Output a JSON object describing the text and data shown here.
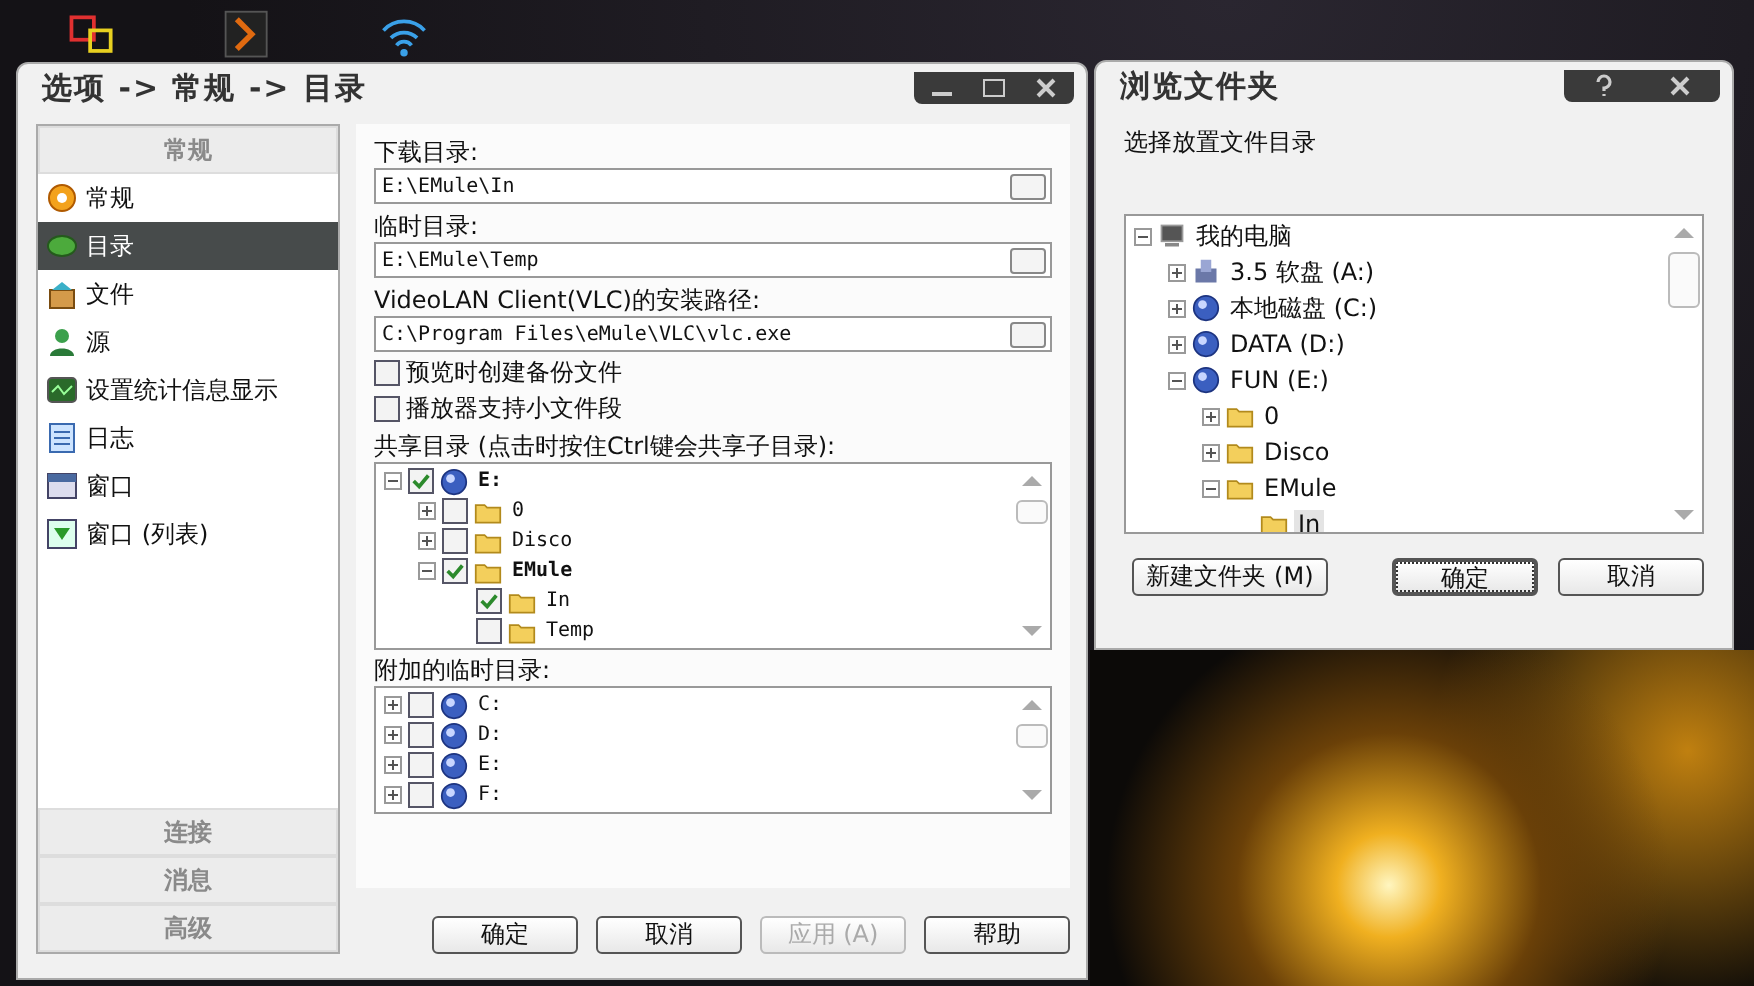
{
  "main_window": {
    "title": "选项 -> 常规 -> 目录",
    "sidebar": {
      "top_section": "常规",
      "items": [
        {
          "label": "常规",
          "kind": "general",
          "selected": false
        },
        {
          "label": "目录",
          "kind": "folder",
          "selected": true
        },
        {
          "label": "文件",
          "kind": "file",
          "selected": false
        },
        {
          "label": "源",
          "kind": "source",
          "selected": false
        },
        {
          "label": "设置统计信息显示",
          "kind": "stats",
          "selected": false
        },
        {
          "label": "日志",
          "kind": "log",
          "selected": false
        },
        {
          "label": "窗口",
          "kind": "window",
          "selected": false
        },
        {
          "label": "窗口 (列表)",
          "kind": "window-list",
          "selected": false
        }
      ],
      "bottom_sections": [
        "连接",
        "消息",
        "高级"
      ]
    },
    "fields": [
      {
        "label": "下载目录:",
        "value": "E:\\EMule\\In"
      },
      {
        "label": "临时目录:",
        "value": "E:\\EMule\\Temp"
      },
      {
        "label": "VideoLAN Client(VLC)的安装路径:",
        "value": "C:\\Program Files\\eMule\\VLC\\vlc.exe"
      }
    ],
    "options": [
      {
        "label": "预览时创建备份文件",
        "checked": false
      },
      {
        "label": "播放器支持小文件段",
        "checked": false
      }
    ],
    "shared": {
      "label": "共享目录 (点击时按住Ctrl键会共享子目录):",
      "tree": [
        {
          "label": "E:",
          "kind": "drive",
          "checked": true,
          "bold": true,
          "expanded": true,
          "children": [
            {
              "label": "0",
              "kind": "folder",
              "checked": false,
              "bold": false,
              "expanded": false
            },
            {
              "label": "Disco",
              "kind": "folder",
              "checked": false,
              "bold": false,
              "expanded": false
            },
            {
              "label": "EMule",
              "kind": "folder",
              "checked": true,
              "bold": true,
              "expanded": true,
              "children": [
                {
                  "label": "In",
                  "kind": "folder",
                  "checked": true,
                  "bold": false
                },
                {
                  "label": "Temp",
                  "kind": "folder",
                  "checked": false,
                  "bold": false
                }
              ]
            }
          ]
        }
      ]
    },
    "extra_temp": {
      "label": "附加的临时目录:",
      "tree": [
        {
          "label": "C:",
          "kind": "drive",
          "checked": false,
          "bold": false,
          "expanded": false
        },
        {
          "label": "D:",
          "kind": "drive",
          "checked": false,
          "bold": false,
          "expanded": false
        },
        {
          "label": "E:",
          "kind": "drive",
          "checked": false,
          "bold": false,
          "expanded": false
        },
        {
          "label": "F:",
          "kind": "drive",
          "checked": false,
          "bold": false,
          "expanded": false
        }
      ]
    },
    "buttons": [
      {
        "label": "确定",
        "disabled": false
      },
      {
        "label": "取消",
        "disabled": false
      },
      {
        "label": "应用 (A)",
        "disabled": true
      },
      {
        "label": "帮助",
        "disabled": false
      }
    ]
  },
  "browse_window": {
    "title": "浏览文件夹",
    "prompt": "选择放置文件目录",
    "tree": [
      {
        "label": "我的电脑",
        "kind": "computer",
        "expanded": true,
        "selected": false,
        "children": [
          {
            "label": "3.5 软盘 (A:)",
            "kind": "floppy",
            "expanded": false,
            "selected": false
          },
          {
            "label": "本地磁盘 (C:)",
            "kind": "drive",
            "expanded": false,
            "selected": false
          },
          {
            "label": "DATA (D:)",
            "kind": "drive",
            "expanded": false,
            "selected": false
          },
          {
            "label": "FUN (E:)",
            "kind": "drive",
            "expanded": true,
            "selected": false,
            "children": [
              {
                "label": "0",
                "kind": "folder",
                "expanded": false,
                "selected": false
              },
              {
                "label": "Disco",
                "kind": "folder",
                "expanded": false,
                "selected": false
              },
              {
                "label": "EMule",
                "kind": "folder",
                "expanded": true,
                "selected": false,
                "children": [
                  {
                    "label": "In",
                    "kind": "folder",
                    "selected": true
                  }
                ]
              }
            ]
          }
        ]
      }
    ],
    "buttons": [
      {
        "label": "新建文件夹 (M)",
        "default": false
      },
      {
        "label": "确定",
        "default": true
      },
      {
        "label": "取消",
        "default": false
      }
    ]
  }
}
